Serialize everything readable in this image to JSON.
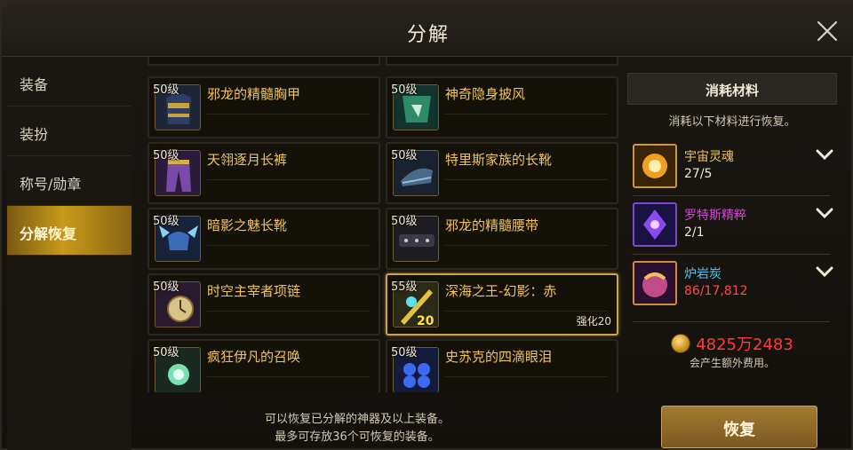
{
  "window": {
    "title": "分解"
  },
  "sidebar": {
    "items": [
      {
        "label": "装备",
        "active": false
      },
      {
        "label": "装扮",
        "active": false
      },
      {
        "label": "称号/勋章",
        "active": false
      },
      {
        "label": "分解恢复",
        "active": true
      }
    ]
  },
  "items": [
    {
      "level": "50级",
      "name": "邪龙的精髓胸甲",
      "icon": "chest-armor-icon"
    },
    {
      "level": "50级",
      "name": "神奇隐身披风",
      "icon": "cloak-icon"
    },
    {
      "level": "50级",
      "name": "天翎逐月长裤",
      "icon": "pants-icon"
    },
    {
      "level": "50级",
      "name": "特里斯家族的长靴",
      "icon": "boots-icon"
    },
    {
      "level": "50级",
      "name": "暗影之魅长靴",
      "icon": "winged-boots-icon"
    },
    {
      "level": "50级",
      "name": "邪龙的精髓腰带",
      "icon": "belt-icon"
    },
    {
      "level": "50级",
      "name": "时空主宰者项链",
      "icon": "necklace-icon"
    },
    {
      "level": "55级",
      "name": "深海之王-幻影：赤",
      "icon": "weapon-icon",
      "enhance": "强化20",
      "enhance_badge": "20",
      "selected": true
    },
    {
      "level": "50级",
      "name": "疯狂伊凡的召唤",
      "icon": "summon-icon"
    },
    {
      "level": "50级",
      "name": "史苏克的四滴眼泪",
      "icon": "tears-icon"
    }
  ],
  "footer": {
    "line1": "可以恢复已分解的神器及以上装备。",
    "line2": "最多可存放36个可恢复的装备。"
  },
  "materials": {
    "header": "消耗材料",
    "subtitle": "消耗以下材料进行恢复。",
    "list": [
      {
        "name": "宇宙灵魂",
        "count": "27/5",
        "color": "#f0c45c",
        "icon": "cosmic-soul-icon"
      },
      {
        "name": "罗特斯精粹",
        "count": "2/1",
        "color": "#e040e0",
        "icon": "rotus-essence-icon"
      },
      {
        "name": "炉岩炭",
        "count": "86/17,812",
        "color": "#4fc3f7",
        "count_color": "#ff4a4a",
        "icon": "lava-charcoal-icon"
      }
    ]
  },
  "cost": {
    "value": "4825万2483",
    "note": "会产生额外费用。",
    "icon": "gold-coin-icon"
  },
  "action": {
    "restore_label": "恢复"
  }
}
